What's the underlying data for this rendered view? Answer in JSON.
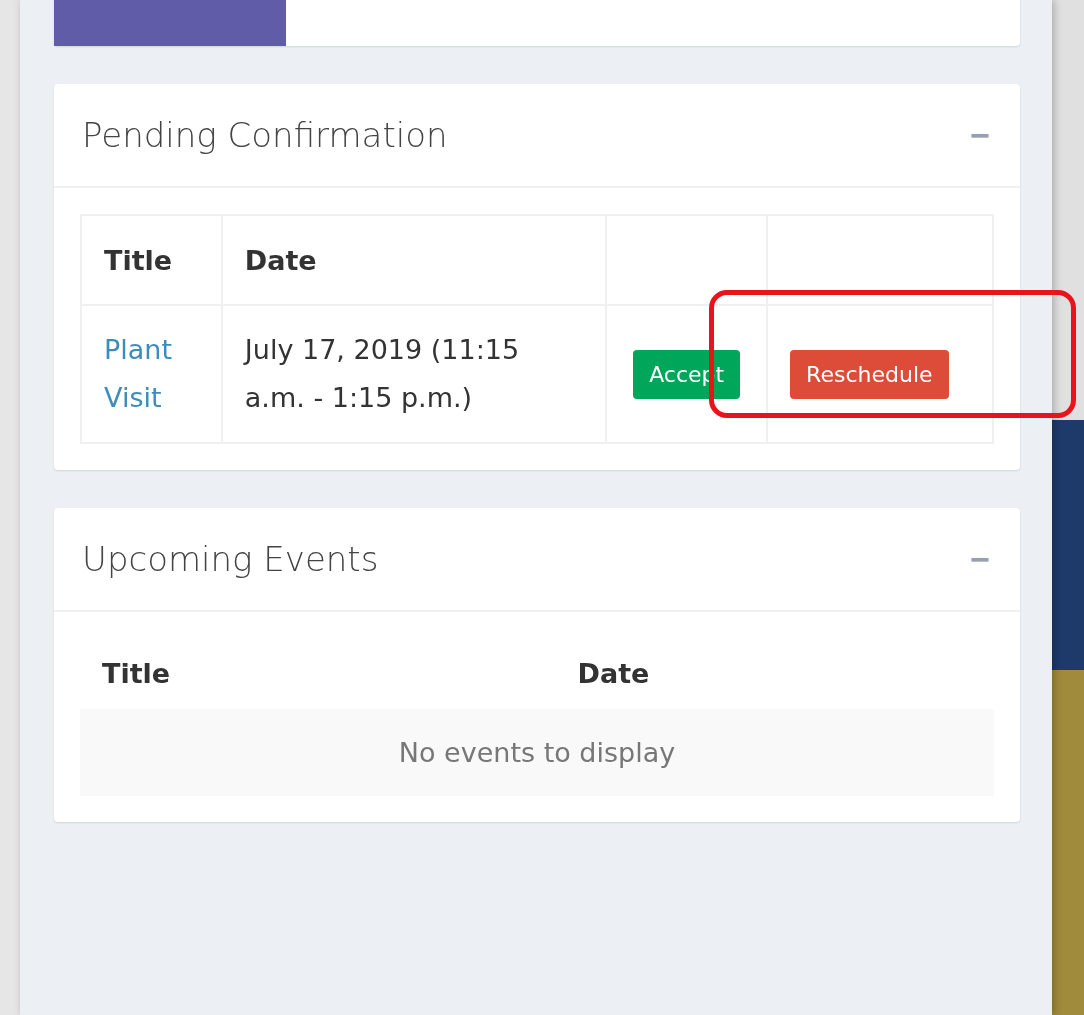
{
  "progress": {
    "level": 0.24
  },
  "pending": {
    "title": "Pending Confirmation",
    "collapse_icon": "−",
    "columns": [
      "Title",
      "Date"
    ],
    "rows": [
      {
        "title": "Plant Visit",
        "date": "July 17, 2019 (11:15 a.m. - 1:15 p.m.)",
        "accept": "Accept",
        "reschedule": "Reschedule",
        "highlighted": true
      }
    ]
  },
  "upcoming": {
    "title": "Upcoming Events",
    "collapse_icon": "−",
    "columns": [
      "Title",
      "Date"
    ],
    "empty": "No events to display"
  }
}
